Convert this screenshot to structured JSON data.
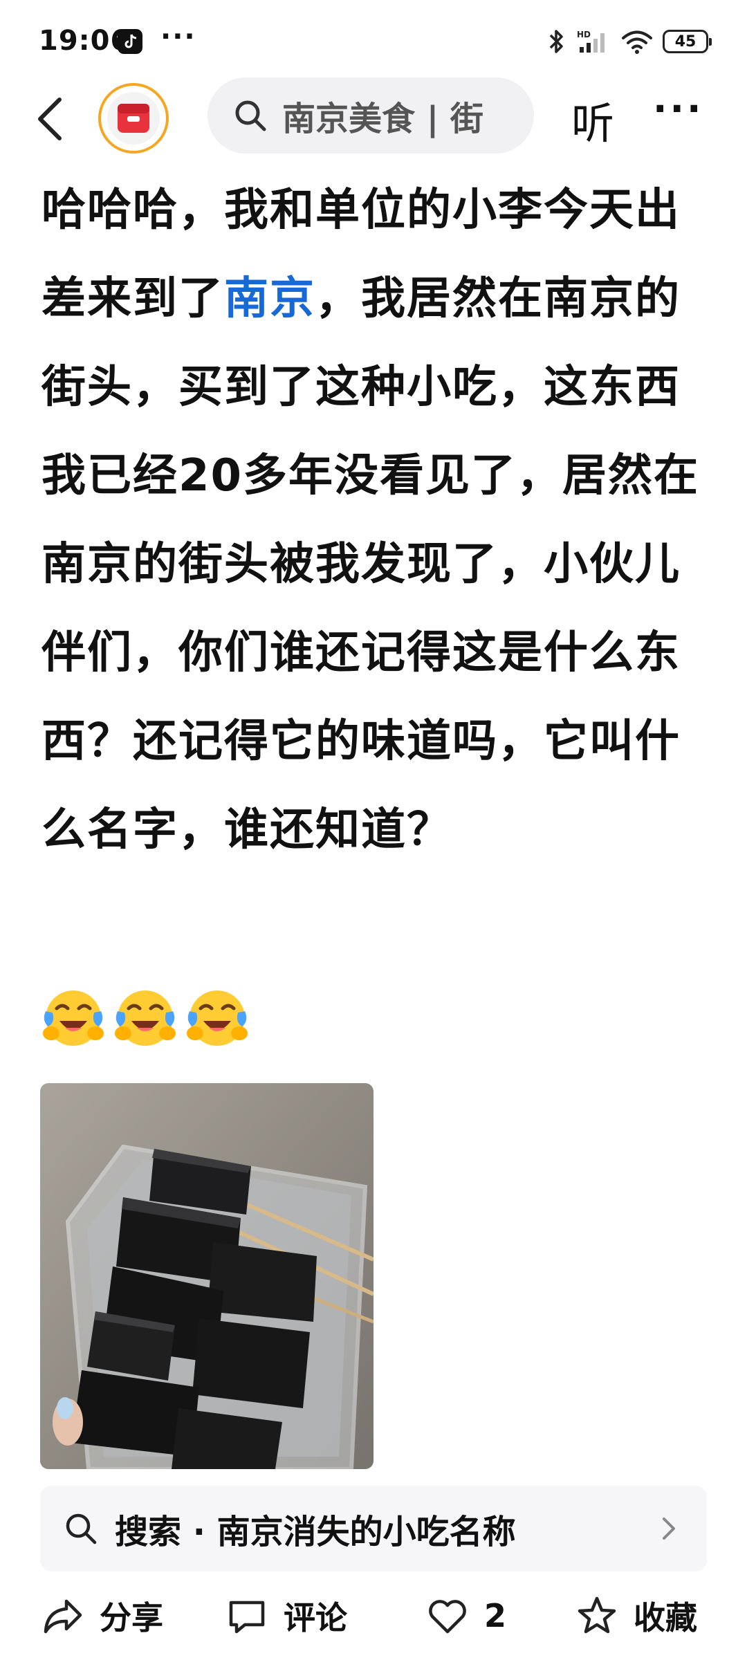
{
  "status_bar": {
    "time": "19:06",
    "more": "···",
    "battery": "45",
    "network_label": "HD"
  },
  "nav": {
    "search_placeholder": "南京美食 | 街",
    "listen_label": "听",
    "more_label": "···"
  },
  "post": {
    "text_before_link": "哈哈哈，我和单位的小李今天出差来到了",
    "link_text": "南京",
    "text_after_link": "，我居然在南京的街头，买到了这种小吃，这东西我已经20多年没看见了，居然在南京的街头被我发现了，小伙儿伴们，你们谁还记得这是什么东西？还记得它的味道吗，它叫什么名字，谁还知道？",
    "emojis": [
      "laughing-crying-emoji",
      "laughing-crying-emoji",
      "laughing-crying-emoji"
    ]
  },
  "related_search": {
    "label": "搜索 · 南京消失的小吃名称"
  },
  "actions": {
    "share_label": "分享",
    "comment_label": "评论",
    "like_count": "2",
    "favorite_label": "收藏"
  },
  "colors": {
    "link": "#1769d6",
    "avatar_red": "#e8323c",
    "avatar_ring": "#f5a623",
    "search_bg": "#f1f1f3"
  }
}
